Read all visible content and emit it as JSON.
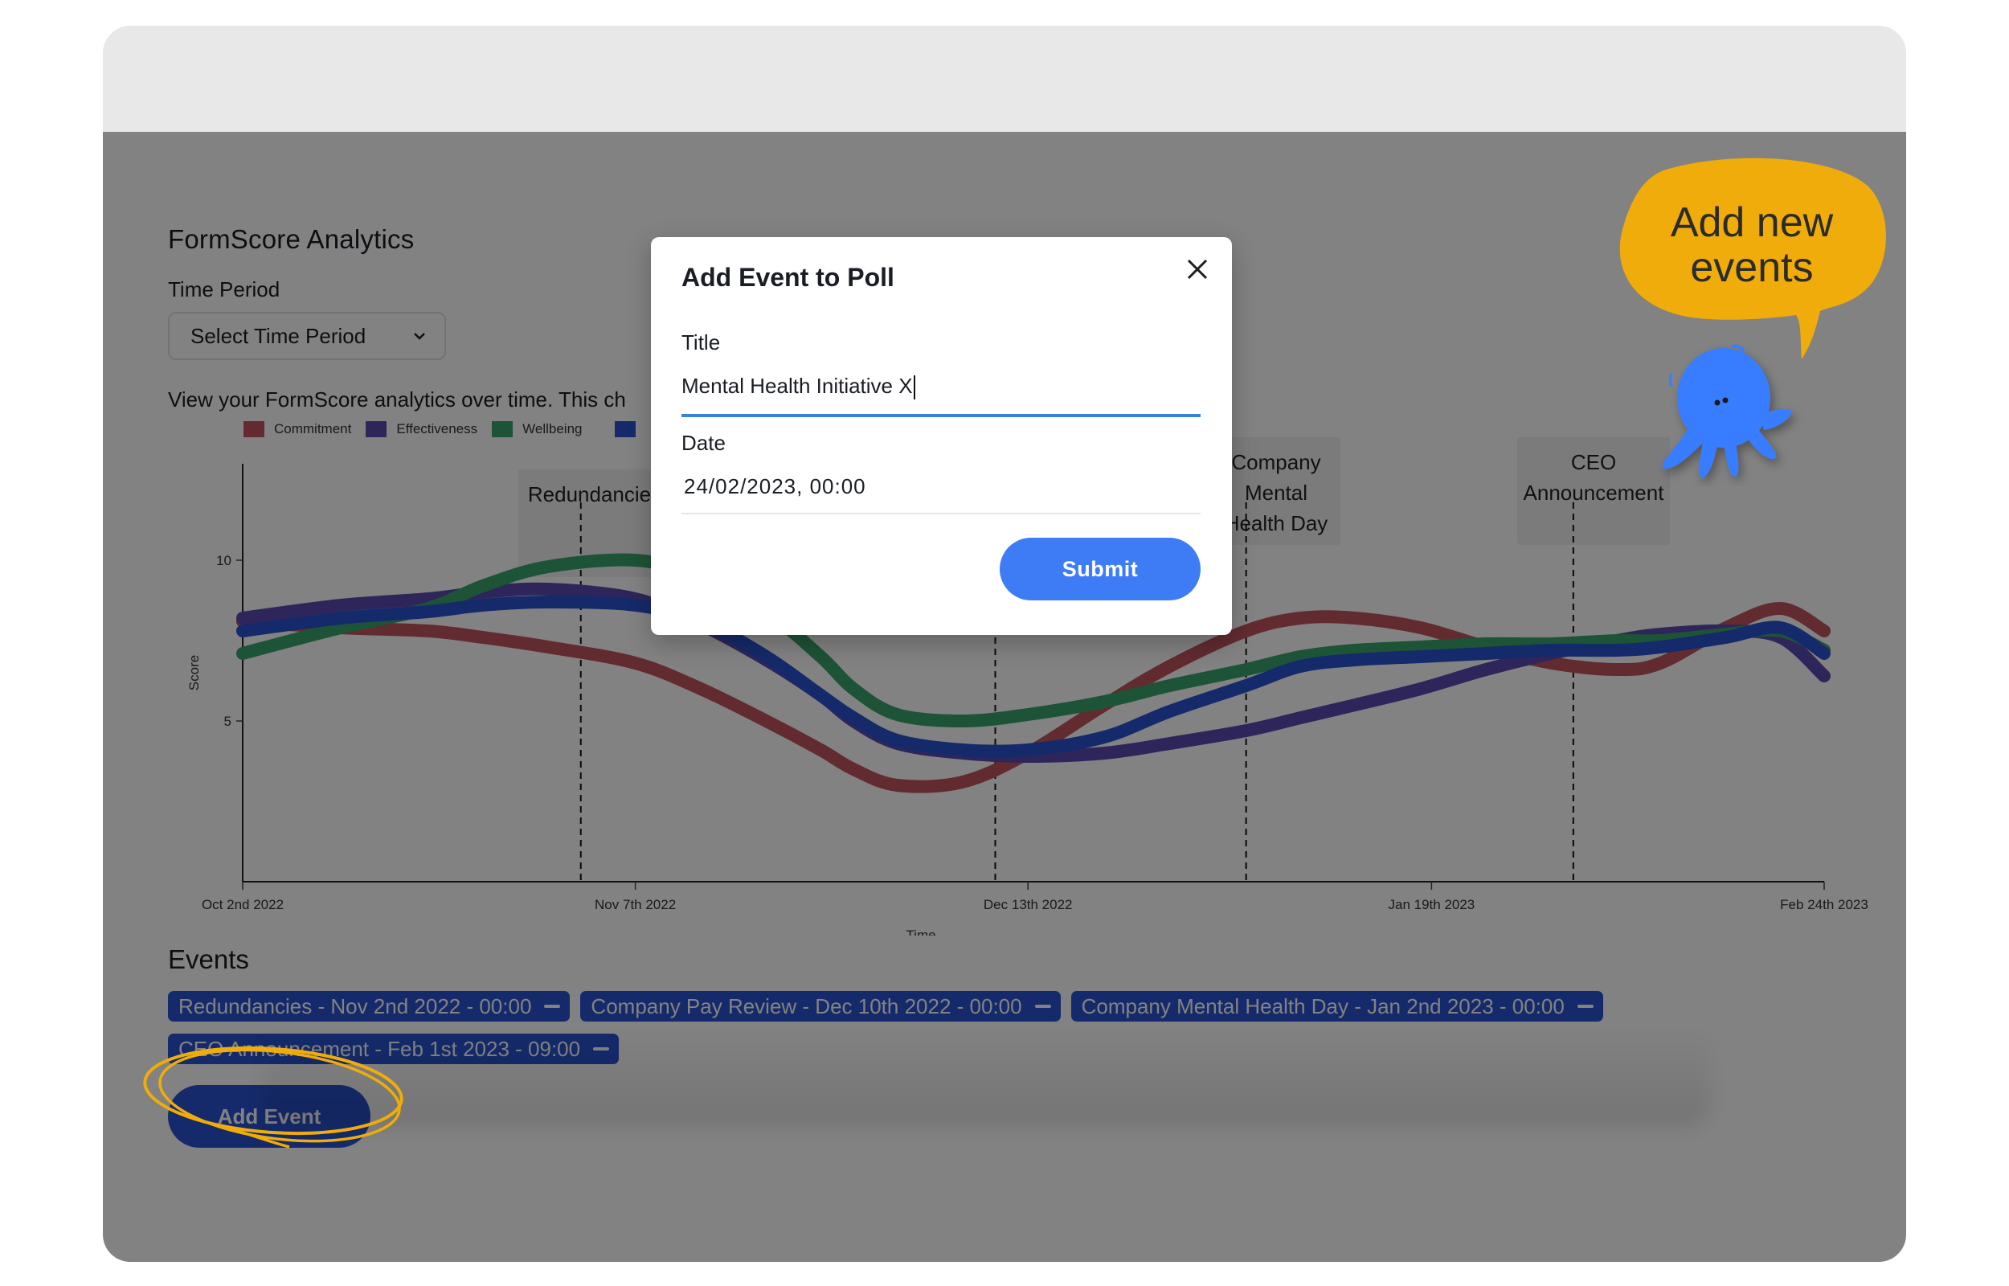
{
  "page": {
    "title": "FormScore Analytics",
    "time_period_label": "Time Period",
    "time_period_select": {
      "value": "Select Time Period"
    },
    "description": "View your FormScore analytics over time. This ch"
  },
  "legend": [
    {
      "label": "Commitment",
      "color": "#c0555f"
    },
    {
      "label": "Effectiveness",
      "color": "#5a4bb0"
    },
    {
      "label": "Wellbeing",
      "color": "#3aa46a"
    },
    {
      "label": "",
      "color": "#2a54d0"
    }
  ],
  "chart_event_labels": [
    {
      "label": "Redundancies",
      "date": "2022-11-02"
    },
    {
      "label": "Company Pay Review",
      "date": "2022-12-10"
    },
    {
      "label": "Company Mental Health Day",
      "date": "2023-01-02"
    },
    {
      "label": "CEO Announcement",
      "date": "2023-02-01"
    }
  ],
  "chart_data": {
    "type": "line",
    "title": "",
    "xlabel": "Time",
    "ylabel": "Score",
    "ylim": [
      0,
      13
    ],
    "yticks": [
      5,
      10
    ],
    "xtick_labels": [
      "Oct 2nd 2022",
      "Nov 7th 2022",
      "Dec 13th 2022",
      "Jan 19th 2023",
      "Feb 24th 2023"
    ],
    "x_days": [
      0,
      9,
      17,
      22,
      28,
      36,
      42,
      48,
      53,
      56,
      60,
      66,
      72,
      79,
      85,
      92,
      97,
      102,
      108,
      114,
      120,
      126,
      130,
      136,
      141,
      145
    ],
    "series": [
      {
        "name": "Commitment",
        "color": "#c0555f",
        "values": [
          8.1,
          7.9,
          7.8,
          7.6,
          7.3,
          6.8,
          6.0,
          5.0,
          4.1,
          3.5,
          3.0,
          3.1,
          4.0,
          5.5,
          6.7,
          7.8,
          8.2,
          8.2,
          7.9,
          7.3,
          6.8,
          6.6,
          6.8,
          7.9,
          8.5,
          7.8
        ]
      },
      {
        "name": "Effectiveness",
        "color": "#5a4bb0",
        "values": [
          8.2,
          8.6,
          8.8,
          9.0,
          9.1,
          8.8,
          8.0,
          6.9,
          5.8,
          5.0,
          4.3,
          4.0,
          3.9,
          4.0,
          4.3,
          4.7,
          5.1,
          5.5,
          6.0,
          6.6,
          7.1,
          7.5,
          7.7,
          7.8,
          7.6,
          6.4
        ]
      },
      {
        "name": "Wellbeing",
        "color": "#3aa46a",
        "values": [
          7.1,
          7.9,
          8.5,
          9.2,
          9.8,
          10.0,
          9.5,
          8.4,
          7.0,
          6.0,
          5.2,
          5.0,
          5.2,
          5.6,
          6.1,
          6.6,
          7.0,
          7.2,
          7.3,
          7.4,
          7.4,
          7.5,
          7.5,
          7.7,
          7.8,
          7.2
        ]
      },
      {
        "name": "",
        "color": "#2a54d0",
        "values": [
          7.8,
          8.2,
          8.4,
          8.6,
          8.7,
          8.6,
          8.1,
          7.0,
          5.8,
          5.1,
          4.4,
          4.1,
          4.1,
          4.5,
          5.3,
          6.1,
          6.7,
          6.9,
          7.0,
          7.1,
          7.2,
          7.2,
          7.3,
          7.6,
          7.9,
          7.1
        ]
      }
    ],
    "events": [
      {
        "label": "Redundancies",
        "day": 31
      },
      {
        "label": "Company Pay Review",
        "day": 69
      },
      {
        "label": "Company Mental Health Day",
        "day": 92
      },
      {
        "label": "CEO Announcement",
        "day": 122
      }
    ],
    "grid": false,
    "legend_position": "top-left"
  },
  "events_section": {
    "title": "Events",
    "chips": [
      {
        "label": "Redundancies - Nov 2nd 2022 - 00:00"
      },
      {
        "label": "Company Pay Review - Dec 10th 2022 - 00:00"
      },
      {
        "label": "Company Mental Health Day - Jan 2nd 2023 - 00:00"
      },
      {
        "label": "CEO Announcement - Feb 1st 2023 - 09:00"
      }
    ],
    "add_button": "Add Event"
  },
  "modal": {
    "title": "Add Event to Poll",
    "title_label": "Title",
    "title_value": "Mental Health Initiative X",
    "date_label": "Date",
    "date_value": "24/02/2023, 00:00",
    "submit_label": "Submit"
  },
  "callout": {
    "text_line1": "Add new",
    "text_line2": "events",
    "bubble_color": "#f0ac0a",
    "mascot_color": "#377dff"
  }
}
